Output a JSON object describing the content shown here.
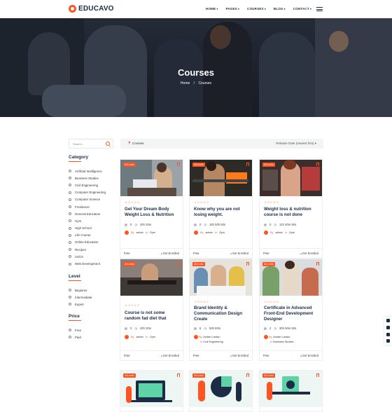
{
  "header": {
    "logo_text": "EDUCAVO",
    "nav": [
      "HOME",
      "PAGES",
      "COURSES",
      "BLOG",
      "CONTACT"
    ]
  },
  "hero": {
    "title": "Courses",
    "breadcrumb_home": "Home",
    "breadcrumb_sep": "/",
    "breadcrumb_current": "Courses"
  },
  "sidebar": {
    "search_placeholder": "Search...",
    "category_title": "Category",
    "categories": [
      "Artificial Intelligence",
      "Business Studies",
      "Civil Engineering",
      "Computer Engineering",
      "Computer Science",
      "Freelancer",
      "General Education",
      "Gym",
      "High School",
      "Life Course",
      "Online Education",
      "Recipes",
      "UX/UI",
      "Web Development"
    ],
    "level_title": "Level",
    "levels": [
      "Beginner",
      "Intermediate",
      "Expert"
    ],
    "price_title": "Price",
    "prices": [
      "Free",
      "Paid"
    ]
  },
  "topbar": {
    "breadcrumb": "Courses",
    "sort": "Release Date (newest first)"
  },
  "courses": [
    {
      "badge": "All Levels",
      "stars": "☆☆☆☆☆",
      "title": "Get Your Dream Body Weight Loss & Nutrition",
      "lessons": "0",
      "duration": "20h 20m",
      "by": "By",
      "author": "admin",
      "in": "In",
      "category": "Gym",
      "price": "Free",
      "enrolled": "Get Enrolled"
    },
    {
      "badge": "All Levels",
      "stars": "☆☆☆☆☆",
      "title": "Know why you are not losing weight.",
      "lessons": "0",
      "duration": "15h 50h 50s",
      "by": "By",
      "author": "admin",
      "in": "In",
      "category": "Gym",
      "price": "Free",
      "enrolled": "Get Enrolled"
    },
    {
      "badge": "All Levels",
      "stars": "☆☆☆☆☆",
      "title": "Weight loss & nutrition course is not done",
      "lessons": "0",
      "duration": "12h 40m 50s",
      "by": "By",
      "author": "admin",
      "in": "In",
      "category": "Gym",
      "price": "Free",
      "enrolled": "Get Enrolled"
    },
    {
      "badge": "All Levels",
      "stars": "☆☆☆☆☆",
      "title": "Course is not some random fad diet that",
      "lessons": "0",
      "duration": "20h 30m",
      "by": "By",
      "author": "admin",
      "in": "In",
      "category": "Gym",
      "price": "Free",
      "enrolled": "Get Enrolled"
    },
    {
      "badge": "All Levels",
      "stars": "☆☆☆☆☆",
      "title": "Brand Identity & Communication Design Create",
      "lessons": "6",
      "duration": "50h 50m",
      "by": "By",
      "author": "Jordan Lukaku",
      "in": "In",
      "category": "Civil Engineering",
      "price": "Free",
      "enrolled": "Get Enrolled"
    },
    {
      "badge": "All Levels",
      "stars": "☆☆☆☆☆",
      "title": "Certificate in Advanced Front-End Development Designer",
      "lessons": "2",
      "duration": "30h 50m 50s",
      "by": "By",
      "author": "Jordan Lukaku",
      "in": "In",
      "category": "Business Studies",
      "price": "Free",
      "enrolled": "Get Enrolled"
    },
    {
      "badge": "All Levels"
    },
    {
      "badge": "All Levels"
    },
    {
      "badge": "All Levels"
    }
  ],
  "colors": {
    "accent": "#ff5421",
    "navy": "#1c2b46"
  }
}
